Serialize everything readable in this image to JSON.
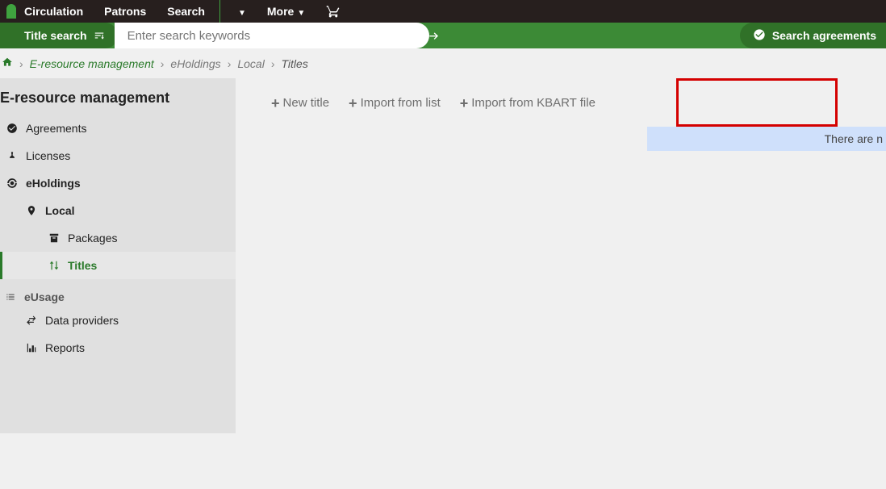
{
  "topnav": {
    "circulation": "Circulation",
    "patrons": "Patrons",
    "search": "Search",
    "more": "More"
  },
  "greenbar": {
    "title_search": "Title search",
    "placeholder": "Enter search keywords",
    "search_agreements": "Search agreements"
  },
  "breadcrumb": {
    "erm": "E-resource management",
    "eholdings": "eHoldings",
    "local": "Local",
    "titles": "Titles"
  },
  "sidebar": {
    "heading": "E-resource management",
    "agreements": "Agreements",
    "licenses": "Licenses",
    "eholdings": "eHoldings",
    "local": "Local",
    "packages": "Packages",
    "titles": "Titles",
    "eusage_group": "eUsage",
    "data_providers": "Data providers",
    "reports": "Reports"
  },
  "toolbar": {
    "new_title": "New title",
    "import_list": "Import from list",
    "import_kbart": "Import from KBART file"
  },
  "notice": {
    "text": "There are n"
  }
}
